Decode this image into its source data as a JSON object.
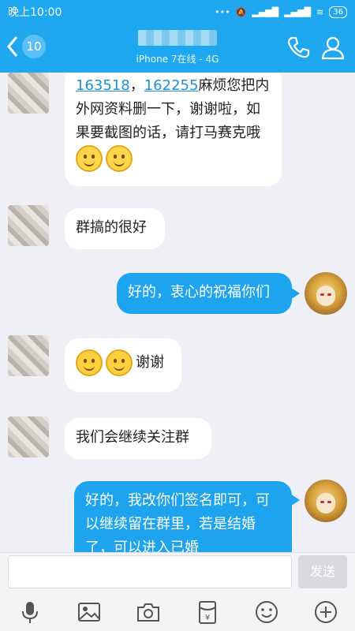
{
  "status_bar": {
    "time": "晚上10:00",
    "battery": "36"
  },
  "header": {
    "unread_count": "10",
    "subtitle": "iPhone 7在线 - 4G"
  },
  "messages": [
    {
      "side": "in",
      "parts": [
        "163518",
        "，",
        "162255",
        "麻烦您把内外网资料删一下，谢谢啦，如果要截图的话，请打马赛克哦"
      ]
    },
    {
      "side": "in",
      "text": "群搞的很好"
    },
    {
      "side": "out",
      "text": "好的，衷心的祝福你们"
    },
    {
      "side": "in",
      "text": "谢谢"
    },
    {
      "side": "in",
      "text": "我们会继续关注群"
    },
    {
      "side": "out",
      "text": "好的，我改你们签名即可，可以继续留在群里，若是结婚了，可以进入已婚"
    }
  ],
  "input": {
    "placeholder": "",
    "send_label": "发送"
  },
  "toolbar": [
    "microphone-icon",
    "image-icon",
    "camera-icon",
    "red-packet-icon",
    "emoji-icon",
    "plus-icon"
  ]
}
